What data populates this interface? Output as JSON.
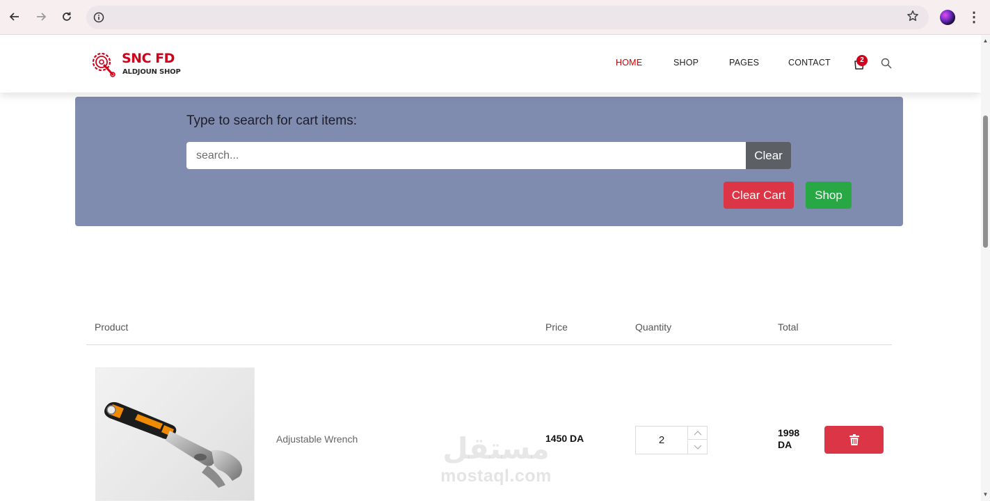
{
  "browser": {
    "back_icon": "arrow-left-icon",
    "forward_icon": "arrow-right-icon",
    "reload_icon": "reload-icon",
    "address_value": "",
    "info_icon": "info-icon",
    "bookmark_icon": "star-icon",
    "menu_icon": "kebab-menu-icon"
  },
  "header": {
    "logo_title": "SNC FD",
    "logo_subtitle": "ALDJOUN SHOP",
    "brand_color": "#d0021b",
    "nav": [
      {
        "label": "HOME",
        "active": true
      },
      {
        "label": "SHOP",
        "active": false
      },
      {
        "label": "PAGES",
        "active": false
      },
      {
        "label": "CONTACT",
        "active": false
      }
    ],
    "cart_count": "2"
  },
  "search_panel": {
    "heading": "Type to search for cart items:",
    "placeholder": "search...",
    "value": "",
    "clear_label": "Clear",
    "clear_cart_label": "Clear Cart",
    "shop_label": "Shop",
    "panel_color": "#808bb0"
  },
  "cart": {
    "headers": {
      "product": "Product",
      "price": "Price",
      "quantity": "Quantity",
      "total": "Total"
    },
    "items": [
      {
        "name": "Adjustable Wrench",
        "price": "1450 DA",
        "quantity": "2",
        "total": "1998 DA",
        "delete_icon": "trash-icon"
      }
    ]
  },
  "watermark": {
    "arabic": "مستقل",
    "latin": "mostaql.com"
  }
}
